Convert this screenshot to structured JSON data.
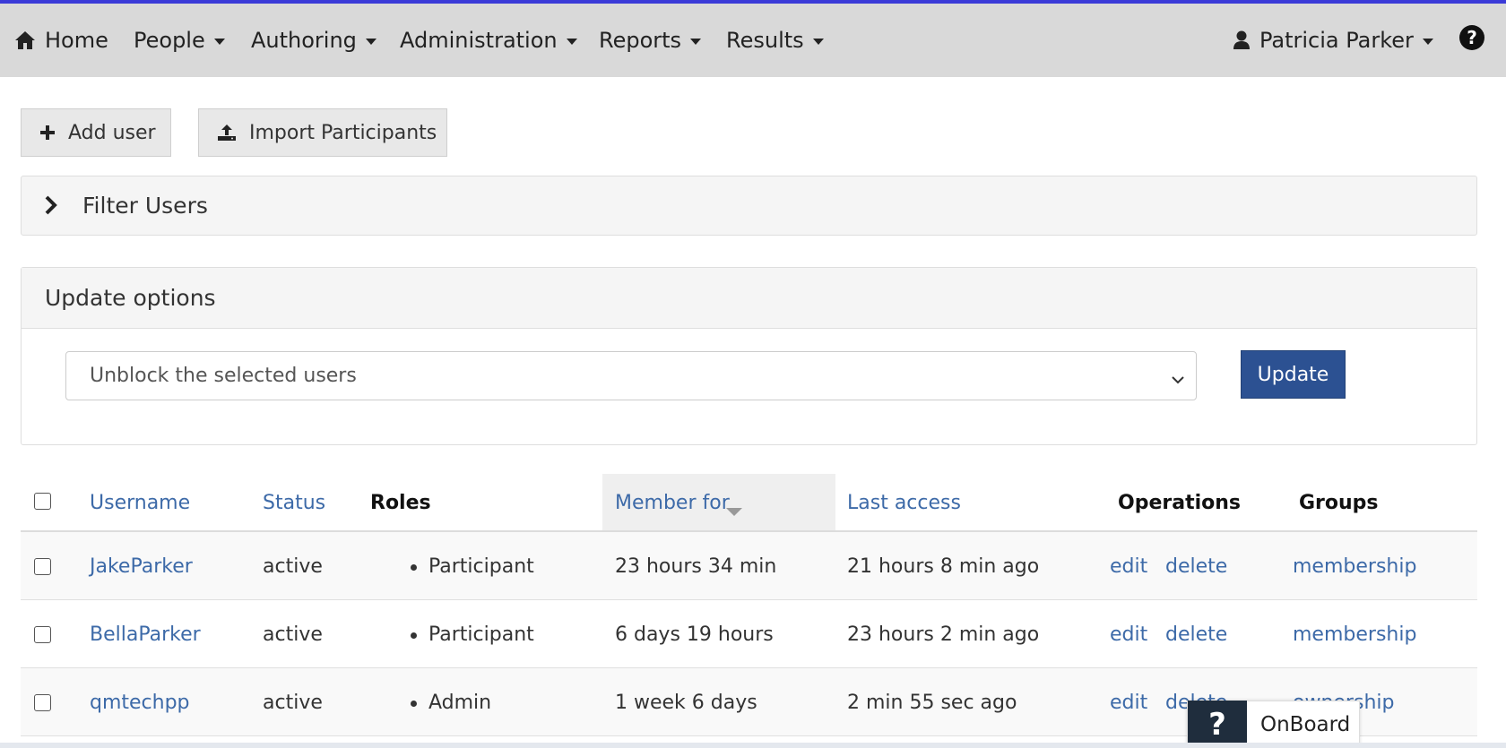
{
  "nav": {
    "home": "Home",
    "people": "People",
    "authoring": "Authoring",
    "administration": "Administration",
    "reports": "Reports",
    "results": "Results",
    "user": "Patricia Parker"
  },
  "actions": {
    "add_user": "Add user",
    "import_participants": "Import Participants"
  },
  "filter": {
    "title": "Filter Users"
  },
  "update_options": {
    "title": "Update options",
    "selected": "Unblock the selected users",
    "button": "Update"
  },
  "table": {
    "headers": {
      "username": "Username",
      "status": "Status",
      "roles": "Roles",
      "member_for": "Member for",
      "last_access": "Last access",
      "operations": "Operations",
      "groups": "Groups"
    },
    "rows": [
      {
        "username": "JakeParker",
        "status": "active",
        "role": "Participant",
        "member_for": "23 hours 34 min",
        "last_access": "21 hours 8 min ago",
        "edit": "edit",
        "delete": "delete",
        "group": "membership"
      },
      {
        "username": "BellaParker",
        "status": "active",
        "role": "Participant",
        "member_for": "6 days 19 hours",
        "last_access": "23 hours 2 min ago",
        "edit": "edit",
        "delete": "delete",
        "group": "membership"
      },
      {
        "username": "qmtechpp",
        "status": "active",
        "role": "Admin",
        "member_for": "1 week 6 days",
        "last_access": "2 min 55 sec ago",
        "edit": "edit",
        "delete": "delete",
        "group": "ownership"
      }
    ]
  },
  "onboard": {
    "icon": "?",
    "label": "OnBoard"
  },
  "colors": {
    "accent": "#3b3bd8",
    "primary_button": "#2c5192",
    "link": "#3d6aa8"
  }
}
